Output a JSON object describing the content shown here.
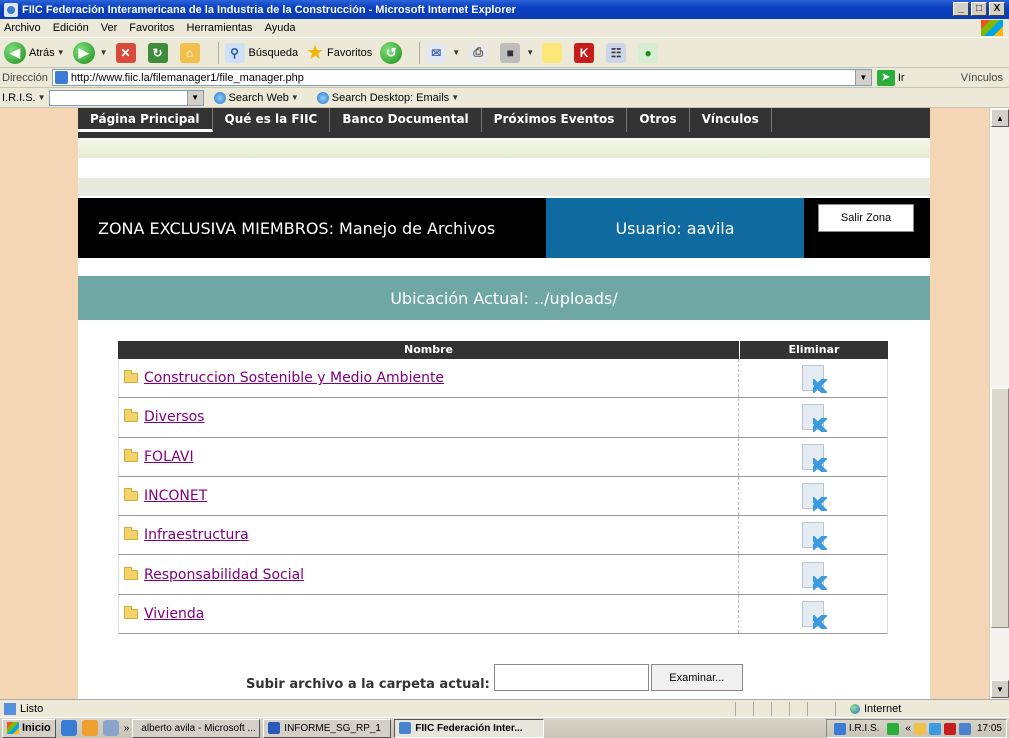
{
  "window": {
    "title": "FIIC Federación Interamericana de la Industria de la Construcción - Microsoft Internet Explorer",
    "controls": [
      "_",
      "□",
      "X"
    ]
  },
  "menubar": [
    "Archivo",
    "Edición",
    "Ver",
    "Favoritos",
    "Herramientas",
    "Ayuda"
  ],
  "toolbar": {
    "back_label": "Atrás",
    "search_label": "Búsqueda",
    "favorites_label": "Favoritos"
  },
  "address": {
    "label": "Dirección",
    "url": "http://www.fiic.la/filemanager1/file_manager.php",
    "go_label": "Ir",
    "links_label": "Vínculos"
  },
  "iris_bar": {
    "label": "I.R.I.S.",
    "search_web": "Search Web",
    "search_desktop": "Search Desktop: Emails"
  },
  "site_nav": [
    "Página Principal",
    "Qué es la FIIC",
    "Banco Documental",
    "Próximos Eventos",
    "Otros",
    "Vínculos"
  ],
  "zone": {
    "title": "ZONA EXCLUSIVA MIEMBROS: Manejo de Archivos",
    "user": "Usuario: aavila",
    "exit_label": "Salir Zona"
  },
  "location": "Ubicación Actual: ../uploads/",
  "files_table": {
    "headers": {
      "name": "Nombre",
      "delete": "Eliminar"
    },
    "rows": [
      {
        "name": "Construccion Sostenible y Medio Ambiente",
        "visited": true
      },
      {
        "name": "Diversos",
        "visited": true
      },
      {
        "name": "FOLAVI",
        "visited": true
      },
      {
        "name": "INCONET",
        "visited": true
      },
      {
        "name": "Infraestructura",
        "visited": true
      },
      {
        "name": "Responsabilidad Social",
        "visited": true
      },
      {
        "name": "Vivienda",
        "visited": true
      }
    ]
  },
  "upload": {
    "label": "Subir archivo a la carpeta actual:",
    "browse_label": "Examinar..."
  },
  "statusbar": {
    "status": "Listo",
    "zone": "Internet"
  },
  "taskbar": {
    "start_label": "Inicio",
    "tasks": [
      "alberto avila - Microsoft ...",
      "INFORME_SG_RP_1",
      "FIIC Federación Inter..."
    ],
    "tray_label": "I.R.I.S.",
    "time": "17:05"
  },
  "colors": {
    "page_bg": "#f5d6b4",
    "nav_bg": "#333333",
    "user_panel": "#0f6aa0",
    "location_bar": "#6fa7a5",
    "visited_link": "#800080"
  }
}
